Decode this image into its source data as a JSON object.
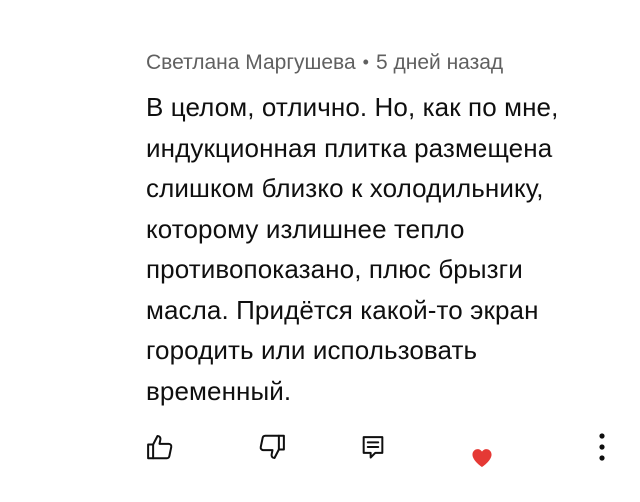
{
  "comment": {
    "author": "Светлана Маргушева",
    "separator": "•",
    "time": "5 дней назад",
    "text_lines": [
      "В целом, отлично. Но, как по мне,",
      "индукционная плитка размещена",
      "слишком близко к холодильнику,",
      "которому излишнее тепло",
      "противопоказано, плюс брызги",
      "масла. Придётся какой-то экран",
      "городить или использовать",
      "временный."
    ]
  },
  "actions": {
    "like_icon": "thumbs-up-icon",
    "dislike_icon": "thumbs-down-icon",
    "reply_icon": "reply-icon",
    "creator_heart_icon": "heart-icon",
    "more_icon": "more-vertical-icon"
  },
  "colors": {
    "text": "#0f0f0f",
    "meta": "#606060",
    "heart": "#e53935"
  }
}
